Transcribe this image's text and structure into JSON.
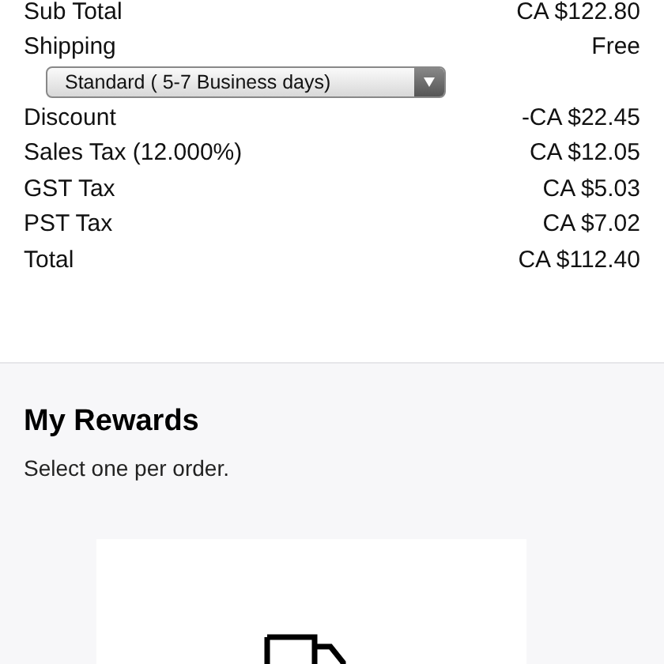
{
  "summary": [
    {
      "label": "Sub Total",
      "value": "CA $122.80"
    },
    {
      "label": "Shipping",
      "value": "Free"
    }
  ],
  "shipping_select": {
    "value": "Standard ( 5-7 Business days)"
  },
  "charges": [
    {
      "label": "Discount",
      "value": "-CA $22.45"
    },
    {
      "label": "Sales Tax (12.000%)",
      "value": "CA $12.05"
    },
    {
      "label": "GST Tax",
      "value": "CA $5.03"
    },
    {
      "label": "PST Tax",
      "value": "CA $7.02"
    },
    {
      "label": "Total",
      "value": "CA $112.40"
    }
  ],
  "rewards": {
    "title": "My Rewards",
    "subtitle": "Select one per order."
  }
}
